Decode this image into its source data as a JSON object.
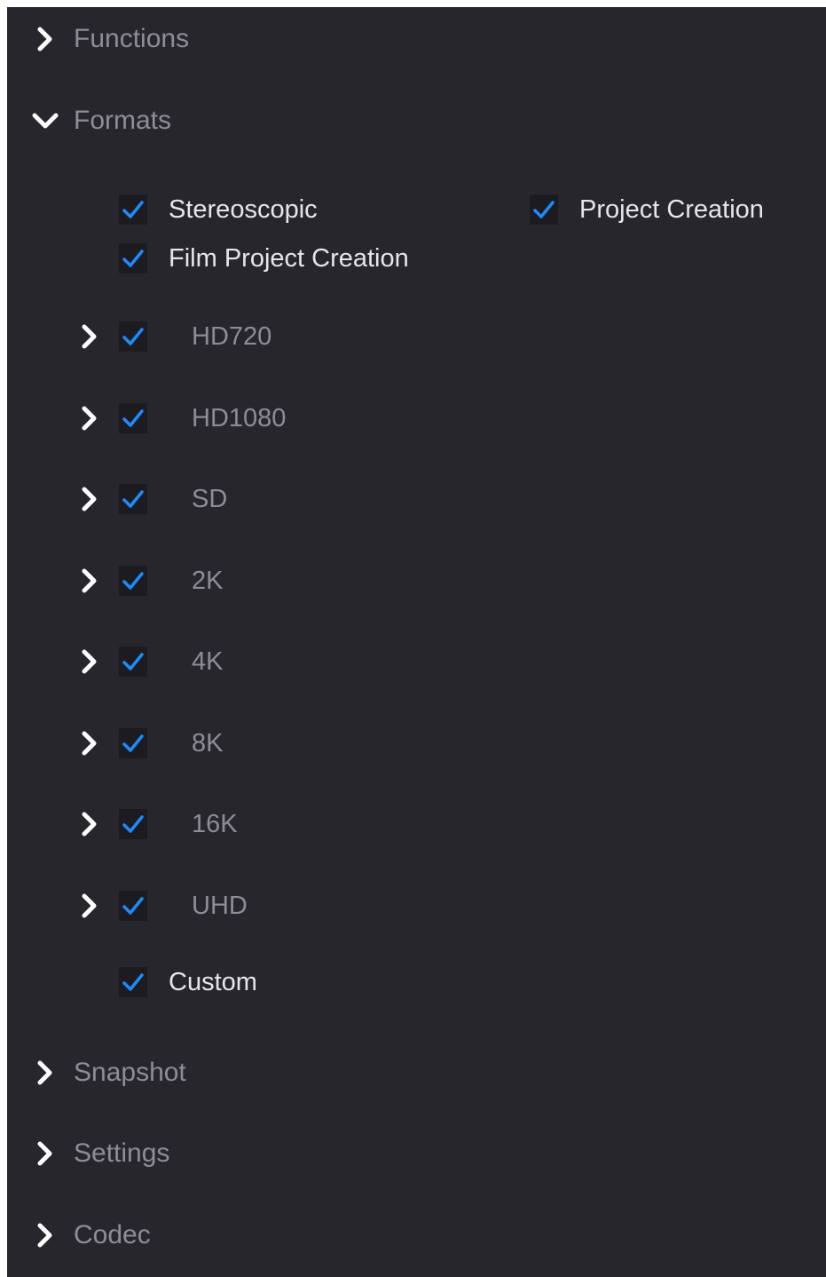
{
  "sections": {
    "functions": {
      "label": "Functions",
      "expanded": false,
      "icon": "chevron-right-icon"
    },
    "formats": {
      "label": "Formats",
      "expanded": true,
      "icon": "chevron-down-icon",
      "options": [
        {
          "label": "Stereoscopic",
          "checked": true
        },
        {
          "label": "Project Creation",
          "checked": true
        },
        {
          "label": "Film Project Creation",
          "checked": true
        }
      ],
      "format_groups": [
        {
          "label": "HD720",
          "checked": true,
          "expanded": false
        },
        {
          "label": "HD1080",
          "checked": true,
          "expanded": false
        },
        {
          "label": "SD",
          "checked": true,
          "expanded": false
        },
        {
          "label": "2K",
          "checked": true,
          "expanded": false
        },
        {
          "label": "4K",
          "checked": true,
          "expanded": false
        },
        {
          "label": "8K",
          "checked": true,
          "expanded": false
        },
        {
          "label": "16K",
          "checked": true,
          "expanded": false
        },
        {
          "label": "UHD",
          "checked": true,
          "expanded": false
        }
      ],
      "custom": {
        "label": "Custom",
        "checked": true
      }
    },
    "snapshot": {
      "label": "Snapshot",
      "expanded": false,
      "icon": "chevron-right-icon"
    },
    "settings": {
      "label": "Settings",
      "expanded": false,
      "icon": "chevron-right-icon"
    },
    "codec": {
      "label": "Codec",
      "expanded": false,
      "icon": "chevron-right-icon"
    }
  },
  "colors": {
    "panel_background": "#26262c",
    "checkbox_background": "#1c1c20",
    "check_accent": "#1a8cff",
    "primary_text": "#e6e6ea",
    "secondary_text": "#8d8d98",
    "chevron": "#ffffff"
  }
}
